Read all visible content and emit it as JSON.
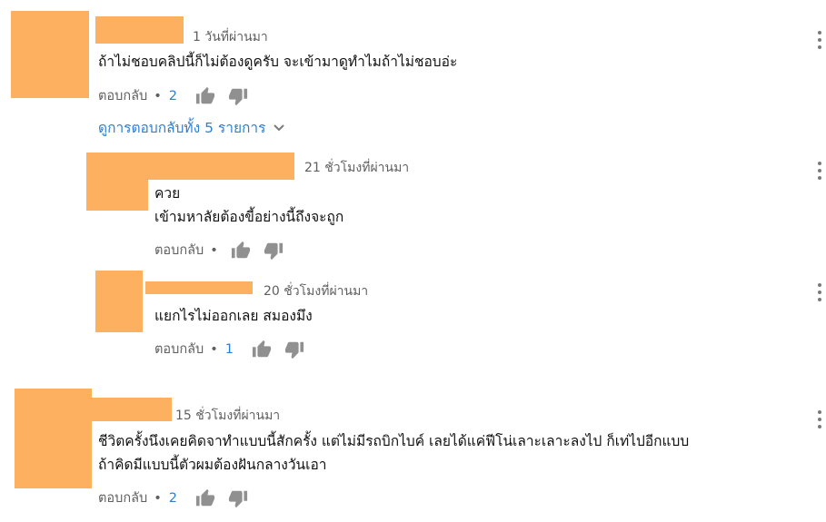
{
  "comments": [
    {
      "timestamp": "1 วันที่ผ่านมา",
      "lines": [
        "ถ้าไม่ชอบคลิปนี้ก็ไม่ต้องดูครับ จะเข้ามาดูทำไมถ้าไม่ชอบอ่ะ"
      ],
      "reply_label": "ตอบกลับ",
      "likes": "2",
      "view_replies": "ดูการตอบกลับทั้ง 5 รายการ"
    },
    {
      "timestamp": "21 ชั่วโมงที่ผ่านมา",
      "lines": [
        "ควย",
        "เข้ามหาลัยต้องขี้อย่างนี้ถึงจะถูก"
      ],
      "reply_label": "ตอบกลับ",
      "likes": ""
    },
    {
      "timestamp": "20 ชั่วโมงที่ผ่านมา",
      "lines": [
        "แยกไรไม่ออกเลย สมองมึง"
      ],
      "reply_label": "ตอบกลับ",
      "likes": "1"
    },
    {
      "timestamp": "15 ชั่วโมงที่ผ่านมา",
      "lines": [
        "ชีวิตครั้งนึงเคยคิดจาทำแบบนี้สักครั้ง แต่ไม่มีรถบิกไบค์ เลยได้แค่ฟีโน่เลาะเลาะลงไป ก็เท่ไปอีกแบบ",
        "ถ้าคิดมีแบบนี้ตัวผมต้องฝันกลางวันเอา"
      ],
      "reply_label": "ตอบกลับ",
      "likes": "2"
    }
  ],
  "separator": "•",
  "icons": {
    "like": "thumbs-up-icon",
    "dislike": "thumbs-down-icon",
    "menu": "more-vertical-icon",
    "expand": "chevron-down-icon"
  },
  "colors": {
    "redaction": "#fdb160",
    "link": "#2d7fd1",
    "meta": "#5f5f5f",
    "icon": "#7a7a7a"
  }
}
